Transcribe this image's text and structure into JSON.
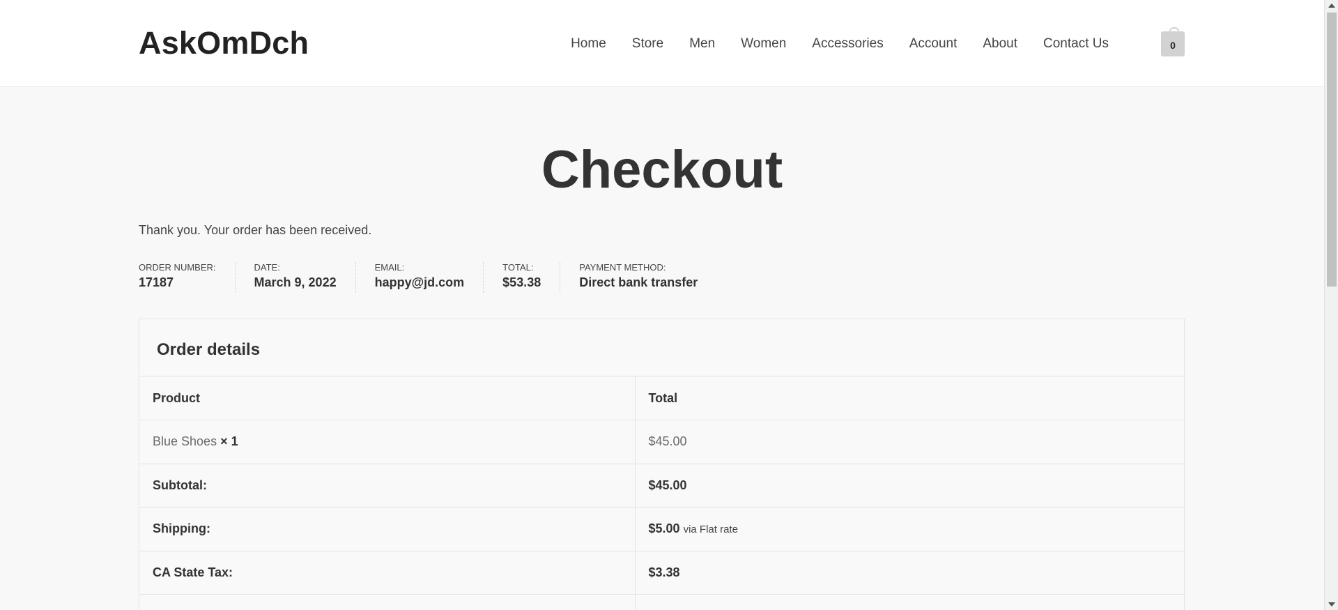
{
  "header": {
    "logo": "AskOmDch",
    "nav": [
      "Home",
      "Store",
      "Men",
      "Women",
      "Accessories",
      "Account",
      "About",
      "Contact Us"
    ],
    "cart_count": "0"
  },
  "page": {
    "title": "Checkout",
    "thanks": "Thank you. Your order has been received."
  },
  "overview": [
    {
      "label": "ORDER NUMBER:",
      "value": "17187"
    },
    {
      "label": "DATE:",
      "value": "March 9, 2022"
    },
    {
      "label": "EMAIL:",
      "value": "happy@jd.com"
    },
    {
      "label": "TOTAL:",
      "value": "$53.38"
    },
    {
      "label": "PAYMENT METHOD:",
      "value": "Direct bank transfer"
    }
  ],
  "order_details": {
    "title": "Order details",
    "headers": {
      "product": "Product",
      "total": "Total"
    },
    "item": {
      "name": "Blue Shoes",
      "qty": "× 1",
      "total": "$45.00"
    },
    "subtotal": {
      "label": "Subtotal:",
      "value": "$45.00"
    },
    "shipping": {
      "label": "Shipping:",
      "value": "$5.00",
      "via": "via Flat rate"
    },
    "tax": {
      "label": "CA State Tax:",
      "value": "$3.38"
    }
  }
}
